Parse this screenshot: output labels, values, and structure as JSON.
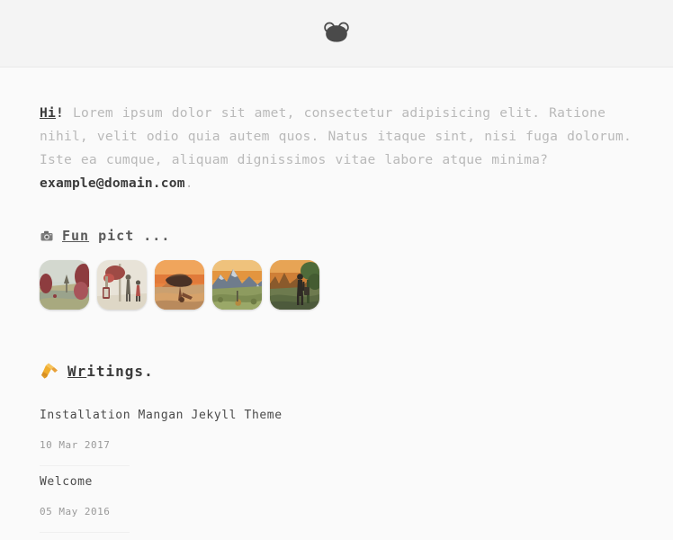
{
  "header": {
    "logo_icon": "bear-face-logo-icon",
    "logo_colors": {
      "face": "#4a4a4a",
      "ear": "#ededed",
      "ear_stroke": "#4a4a4a"
    }
  },
  "intro": {
    "greeting": "Hi",
    "greeting_punct": "! ",
    "body": "Lorem ipsum dolor sit amet, consectetur adipisicing elit. Ratione nihil, velit odio quia autem quos. Natus itaque sint, nisi fuga dolorum. Iste ea cumque, aliquam dignissimos vitae labore atque minima? ",
    "email": "example@domain.com",
    "email_punct": "."
  },
  "fun_section": {
    "icon": "camera-icon",
    "title_underlined": "Fun",
    "title_rest": " pict ...",
    "images": [
      {
        "name": "thumbnail-landscape-red-trees",
        "alt": "Pastel green valley with dark red trees",
        "sky": "#cfd6cd",
        "ground": "#b8b289",
        "accent": "#8d3c3f",
        "accent2": "#a8545a",
        "mid": "#9aa38c"
      },
      {
        "name": "thumbnail-street-figures",
        "alt": "Pale street scene with two figures and a red tree",
        "sky": "#e8e3d8",
        "ground": "#ded7c6",
        "accent": "#9e4a45",
        "accent2": "#c0564f",
        "mid": "#6b6558"
      },
      {
        "name": "thumbnail-desert-rock",
        "alt": "Orange sunset desert with dark floating rock",
        "sky": "#e8833f",
        "ground": "#caa070",
        "accent": "#4a3226",
        "accent2": "#7a4b30",
        "mid": "#d6a26a"
      },
      {
        "name": "thumbnail-mountain-sunset",
        "alt": "Golden sky over snowy mountains and green valley",
        "sky": "#e8a24e",
        "ground": "#8d9b5f",
        "accent": "#6f7c8c",
        "accent2": "#c9d2da",
        "mid": "#b5893f"
      },
      {
        "name": "thumbnail-figure-silhouette",
        "alt": "Dark figure silhouette against a glowing sunset city",
        "sky": "#d98b3e",
        "ground": "#6d7a4e",
        "accent": "#2e2a24",
        "accent2": "#8a5a2c",
        "mid": "#4d5a3c"
      }
    ]
  },
  "writings_section": {
    "icon": "writing-hand-icon",
    "title_underlined": "Wr",
    "title_rest": "itings.",
    "posts": [
      {
        "title": "Installation Mangan Jekyll Theme",
        "date": "10 Mar 2017"
      },
      {
        "title": "Welcome",
        "date": "05 May 2016"
      }
    ]
  }
}
